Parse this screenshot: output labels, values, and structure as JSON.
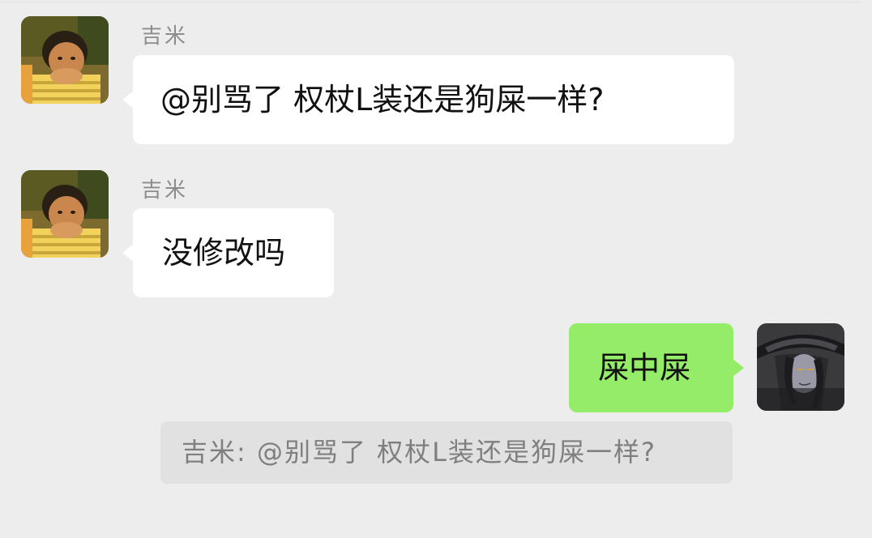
{
  "messages": [
    {
      "sender": "吉米",
      "direction": "incoming",
      "text": "@别骂了 权杖L装还是狗屎一样?"
    },
    {
      "sender": "吉米",
      "direction": "incoming",
      "text": "没修改吗"
    },
    {
      "direction": "outgoing",
      "text": "屎中屎"
    }
  ],
  "quote": {
    "text": "吉米: @别骂了 权杖L装还是狗屎一样?"
  },
  "colors": {
    "background": "#ededed",
    "incoming_bubble": "#ffffff",
    "outgoing_bubble": "#95ec69",
    "quote_background": "#e1e1e1",
    "name_text": "#8c8c8c"
  },
  "icons": {
    "incoming_avatar": "child-photo-avatar",
    "outgoing_avatar": "anime-character-avatar"
  }
}
